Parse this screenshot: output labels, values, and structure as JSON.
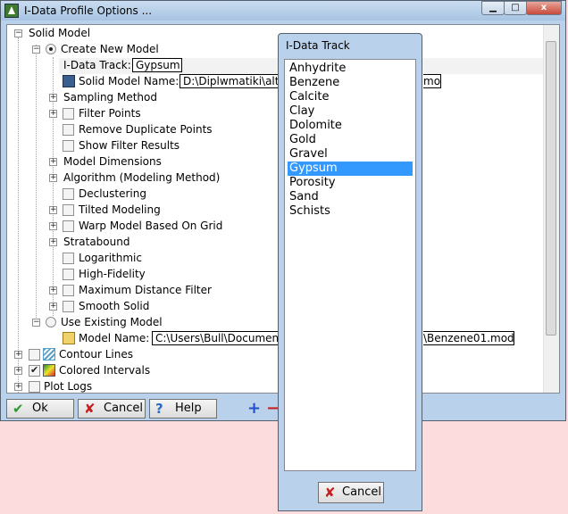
{
  "window": {
    "title": "I-Data Profile Options ...",
    "close_label": "x"
  },
  "tree": {
    "solid_model": "Solid Model",
    "create_new_model": "Create New Model",
    "idata_track_label": "I-Data Track:",
    "idata_track_value": "Gypsum",
    "solid_model_name_label": "Solid Model Name:",
    "solid_model_name_value_left": "D:\\Diplwmatiki\\alts",
    "solid_model_name_value_right": "mod",
    "sampling_method": "Sampling Method",
    "filter_points": "Filter Points",
    "remove_duplicate_points": "Remove Duplicate Points",
    "show_filter_results": "Show Filter Results",
    "model_dimensions": "Model Dimensions",
    "algorithm": "Algorithm (Modeling Method)",
    "declustering": "Declustering",
    "tilted_modeling": "Tilted Modeling",
    "warp_model": "Warp Model Based On Grid",
    "stratabound": "Stratabound",
    "logarithmic": "Logarithmic",
    "high_fidelity": "High-Fidelity",
    "maximum_distance_filter": "Maximum Distance Filter",
    "smooth_solid": "Smooth Solid",
    "use_existing_model": "Use Existing Model",
    "model_name_label": "Model Name:",
    "model_name_value_left": "C:\\Users\\Bull\\Documen",
    "model_name_value_right": "\\Benzene01.mod",
    "contour_lines": "Contour Lines",
    "colored_intervals": "Colored Intervals",
    "plot_logs": "Plot Logs"
  },
  "buttons": {
    "ok": "Ok",
    "cancel": "Cancel",
    "help": "Help"
  },
  "popup": {
    "title": "I-Data Track",
    "items": [
      "Anhydrite",
      "Benzene",
      "Calcite",
      "Clay",
      "Dolomite",
      "Gold",
      "Gravel",
      "Gypsum",
      "Porosity",
      "Sand",
      "Schists"
    ],
    "selected": "Gypsum",
    "cancel": "Cancel"
  },
  "colors": {
    "window_bg": "#b9d1ea",
    "selection": "#3399ff",
    "desktop": "#fcdcdc"
  }
}
